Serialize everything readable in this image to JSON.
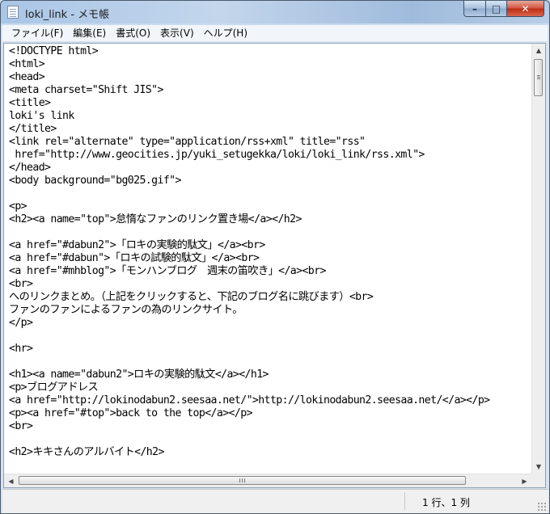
{
  "window": {
    "title": "loki_link - メモ帳",
    "controls": {
      "minimize": "–",
      "maximize": "□",
      "close": "✕"
    }
  },
  "menu": {
    "items": [
      "ファイル(F)",
      "編集(E)",
      "書式(O)",
      "表示(V)",
      "ヘルプ(H)"
    ]
  },
  "editor": {
    "lines": [
      "<!DOCTYPE html>",
      "<html>",
      "<head>",
      "<meta charset=\"Shift JIS\">",
      "<title>",
      "loki's link",
      "</title>",
      "<link rel=\"alternate\" type=\"application/rss+xml\" title=\"rss\"",
      " href=\"http://www.geocities.jp/yuki_setugekka/loki/loki_link/rss.xml\">",
      "</head>",
      "<body background=\"bg025.gif\">",
      "",
      "<p>",
      "<h2><a name=\"top\">怠惰なファンのリンク置き場</a></h2>",
      "",
      "<a href=\"#dabun2\">「ロキの実験的駄文」</a><br>",
      "<a href=\"#dabun\">「ロキの試験的駄文」</a><br>",
      "<a href=\"#mhblog\">「モンハンブログ　週末の笛吹き」</a><br>",
      "<br>",
      "へのリンクまとめ。（上記をクリックすると、下記のブログ名に跳びます）<br>",
      "ファンのファンによるファンの為のリンクサイト。",
      "</p>",
      "",
      "<hr>",
      "",
      "<h1><a name=\"dabun2\">ロキの実験的駄文</a></h1>",
      "<p>ブログアドレス",
      "<a href=\"http://lokinodabun2.seesaa.net/\">http://lokinodabun2.seesaa.net/</a></p>",
      "<p><a href=\"#top\">back to the top</a></p>",
      "<br>",
      "",
      "<h2>キキさんのアルバイト</h2>"
    ]
  },
  "scrollbars": {
    "up_arrow": "▲",
    "down_arrow": "▼",
    "left_arrow": "◀",
    "right_arrow": "▶"
  },
  "status": {
    "position": "1 行、1 列"
  }
}
